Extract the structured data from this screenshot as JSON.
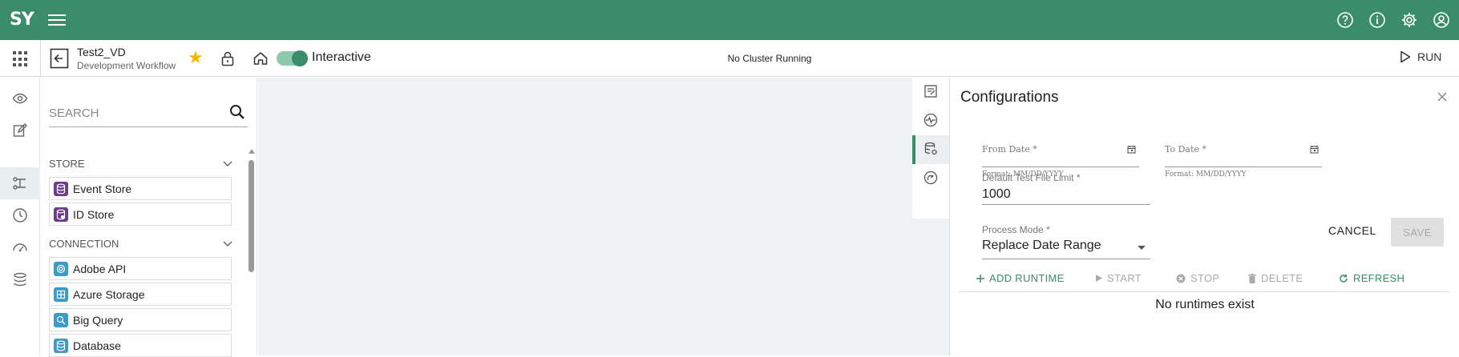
{
  "brand": {
    "logo_text": "SY",
    "color": "#3a8d68"
  },
  "topbar": {
    "icons": [
      "help-icon",
      "info-icon",
      "settings-icon",
      "account-icon"
    ]
  },
  "workflow": {
    "title": "Test2_VD",
    "subtitle": "Development Workflow",
    "favorite": true,
    "mode_label": "Interactive",
    "mode_on": true,
    "cluster_status": "No Cluster Running",
    "run_label": "RUN"
  },
  "left_rail": {
    "icons": [
      "eye-icon",
      "edit-icon",
      "pipeline-icon",
      "clock-icon",
      "dashboard-icon",
      "layers-icon"
    ],
    "active": "pipeline-icon"
  },
  "palette": {
    "search_placeholder": "SEARCH",
    "sections": [
      {
        "title": "STORE",
        "items": [
          "Event Store",
          "ID Store"
        ]
      },
      {
        "title": "CONNECTION",
        "items": [
          "Adobe API",
          "Azure Storage",
          "Big Query",
          "Database"
        ]
      }
    ]
  },
  "config": {
    "title": "Configurations",
    "from_date_label": "From Date *",
    "from_date_hint": "Format: MM/DD/YYYY",
    "to_date_label": "To Date *",
    "to_date_hint": "Format: MM/DD/YYYY",
    "limit_label": "Default Test File Limit *",
    "limit_value": "1000",
    "process_mode_label": "Process Mode *",
    "process_mode_value": "Replace Date Range",
    "cancel_label": "CANCEL",
    "save_label": "SAVE",
    "actions": {
      "add_runtime": "ADD RUNTIME",
      "start": "START",
      "stop": "STOP",
      "delete": "DELETE",
      "refresh": "REFRESH"
    },
    "empty_message": "No runtimes exist"
  }
}
